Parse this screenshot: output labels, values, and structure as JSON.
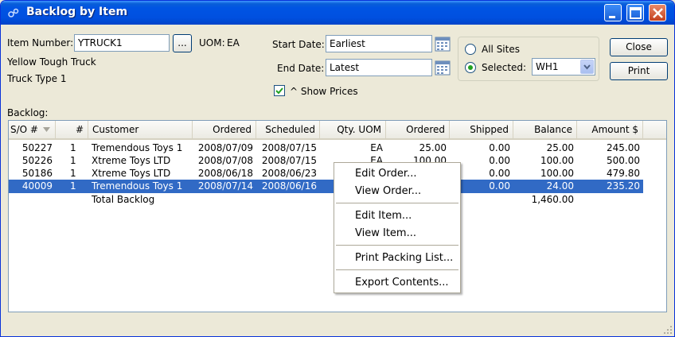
{
  "window": {
    "title": "Backlog by Item"
  },
  "item": {
    "number_label": "Item Number:",
    "number_value": "YTRUCK1",
    "lookup_label": "...",
    "uom_label": "UOM:",
    "uom_value": "EA",
    "description1": "Yellow Tough Truck",
    "description2": "Truck Type 1"
  },
  "dates": {
    "start_label": "Start Date:",
    "start_value": "Earliest",
    "end_label": "End Date:",
    "end_value": "Latest"
  },
  "options": {
    "show_prices_label": "^ Show Prices",
    "show_prices_checked": true
  },
  "sites": {
    "all_label": "All Sites",
    "selected_label": "Selected:",
    "selected_value": "WH1",
    "selected_option": "selected"
  },
  "buttons": {
    "close": "Close",
    "print": "Print"
  },
  "backlog": {
    "label": "Backlog:",
    "columns": [
      "S/O #",
      "#",
      "Customer",
      "Ordered",
      "Scheduled",
      "Qty. UOM",
      "Ordered",
      "Shipped",
      "Balance",
      "Amount $"
    ],
    "rows": [
      {
        "so": "50227",
        "line": "1",
        "customer": "Tremendous Toys 1",
        "ordered_date": "2008/07/09",
        "scheduled": "2008/07/15",
        "uom": "EA",
        "ordered_qty": "25.00",
        "shipped": "0.00",
        "balance": "25.00",
        "amount": "245.00"
      },
      {
        "so": "50226",
        "line": "1",
        "customer": "Xtreme Toys LTD",
        "ordered_date": "2008/07/08",
        "scheduled": "2008/07/15",
        "uom": "EA",
        "ordered_qty": "100.00",
        "shipped": "0.00",
        "balance": "100.00",
        "amount": "500.00"
      },
      {
        "so": "50186",
        "line": "1",
        "customer": "Xtreme Toys LTD",
        "ordered_date": "2008/06/18",
        "scheduled": "2008/06/23",
        "uom": "",
        "ordered_qty": "",
        "shipped": "0.00",
        "balance": "100.00",
        "amount": "479.80"
      },
      {
        "so": "40009",
        "line": "1",
        "customer": "Tremendous Toys 1",
        "ordered_date": "2008/07/14",
        "scheduled": "2008/06/16",
        "uom": "",
        "ordered_qty": "",
        "shipped": "0.00",
        "balance": "24.00",
        "amount": "235.20",
        "selected": true
      }
    ],
    "total_label": "Total Backlog",
    "total_balance": "1,460.00"
  },
  "context_menu": {
    "items": [
      "Edit Order...",
      "View Order...",
      "Edit Item...",
      "View Item...",
      "Print Packing List...",
      "Export Contents..."
    ]
  },
  "colors": {
    "titlebar": "#0054e3",
    "selection": "#316ac5",
    "window_bg": "#ece9d8"
  }
}
